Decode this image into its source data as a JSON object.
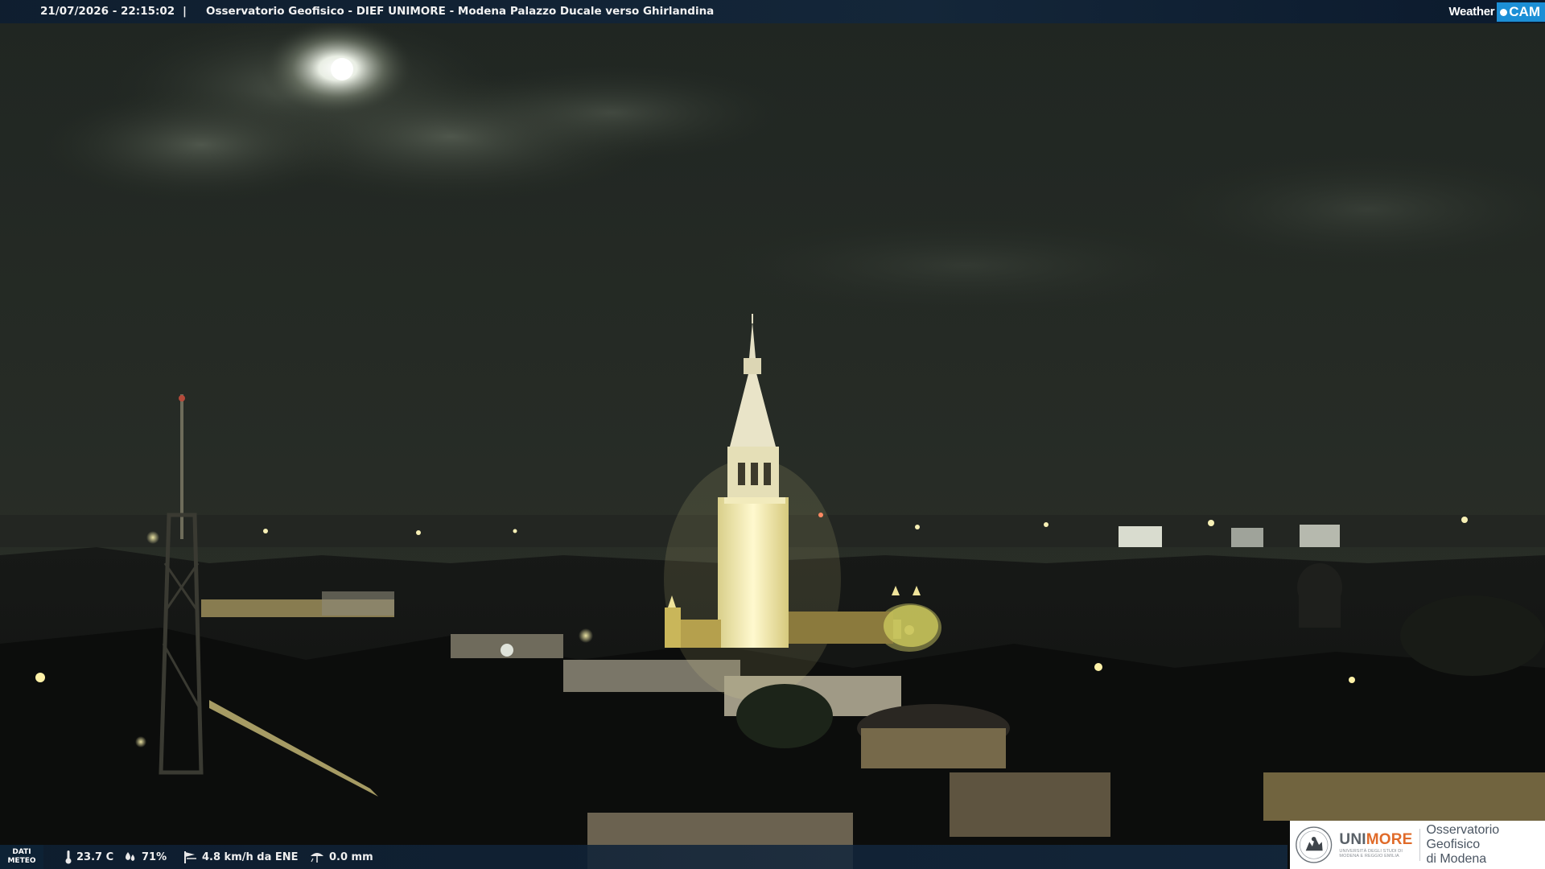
{
  "header": {
    "datetime": "21/07/2026 - 22:15:02",
    "separator": "|",
    "title": "Osservatorio Geofisico - DIEF UNIMORE - Modena Palazzo Ducale verso Ghirlandina"
  },
  "brand": {
    "weather": "Weather",
    "cam": "CAM",
    "cam_color": "#1c8fd6"
  },
  "weather_bar": {
    "label_line1": "DATI",
    "label_line2": "METEO",
    "temperature": "23.7 C",
    "humidity": "71%",
    "wind": "4.8 km/h da ENE",
    "rain": "0.0 mm"
  },
  "logo": {
    "uni": "UNI",
    "more": "MORE",
    "subtitle_line1": "UNIVERSITÀ DEGLI STUDI DI",
    "subtitle_line2": "MODENA E REGGIO EMILIA",
    "observatory_line1": "Osservatorio Geofisico",
    "observatory_line2": "di Modena",
    "accent_color": "#e06b2a"
  },
  "icons": [
    "thermometer-icon",
    "humidity-drops-icon",
    "wind-icon",
    "rain-gauge-icon",
    "university-seal-icon"
  ]
}
